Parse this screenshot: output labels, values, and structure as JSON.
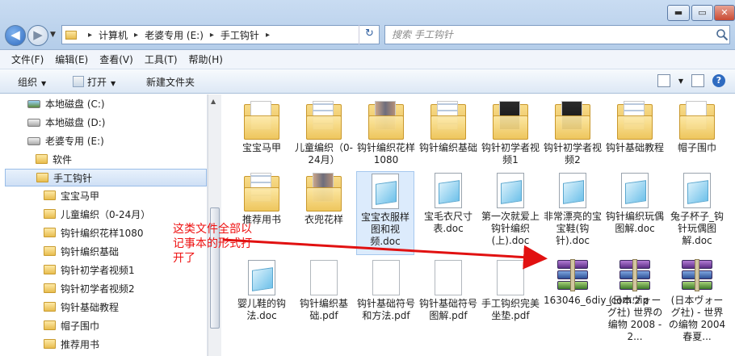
{
  "window": {
    "controls": {
      "minimize": "▬",
      "maximize": "▭",
      "close": "✕"
    }
  },
  "address": {
    "crumbs": [
      "计算机",
      "老婆专用 (E:)",
      "手工钩针"
    ],
    "separator": "▸",
    "refresh": "↻"
  },
  "search": {
    "placeholder": "搜索 手工钩针"
  },
  "menu": [
    "文件(F)",
    "编辑(E)",
    "查看(V)",
    "工具(T)",
    "帮助(H)"
  ],
  "toolbar": {
    "organize": "组织",
    "open": "打开",
    "new_folder": "新建文件夹",
    "help": "?"
  },
  "nav": {
    "drives": [
      "本地磁盘 (C:)",
      "本地磁盘 (D:)",
      "老婆专用 (E:)"
    ],
    "folders_e": [
      "软件",
      "手工钩针"
    ],
    "subfolders": [
      "宝宝马甲",
      "儿童编织（0-24月）",
      "钩针编织花样1080",
      "钩针编织基础",
      "钩针初学者视频1",
      "钩针初学者视频2",
      "钩针基础教程",
      "帽子围巾",
      "推荐用书"
    ]
  },
  "files": {
    "row1": [
      "宝宝马甲",
      "儿童编织（0-24月）",
      "钩针编织花样1080",
      "钩针编织基础",
      "钩针初学者视频1",
      "钩针初学者视频2",
      "钩针基础教程",
      "帽子围巾"
    ],
    "row2": [
      "推荐用书",
      "衣兜花样",
      "宝宝衣服样图和视频.doc",
      "宝毛衣尺寸表.doc",
      "第一次就爱上钩针编织(上).doc",
      "非常漂亮的宝宝鞋(钩针).doc",
      "钩针编织玩偶图解.doc",
      "兔子杯子_钩针玩偶图解.doc"
    ],
    "row3": [
      "婴儿鞋的钩法.doc",
      "钩针编织基础.pdf",
      "钩针基础符号和方法.pdf",
      "钩针基础符号图解.pdf",
      "手工钩织完美坐垫.pdf",
      "163046_6diy_com.zip",
      "(日本ヴォーグ社) 世界の编物 2008 - 2...",
      "(日本ヴォーグ社) - 世界の编物 2004春夏..."
    ]
  },
  "annotation": {
    "text": "这类文件全部以记事本的形式打开了",
    "color": "#e11111"
  }
}
